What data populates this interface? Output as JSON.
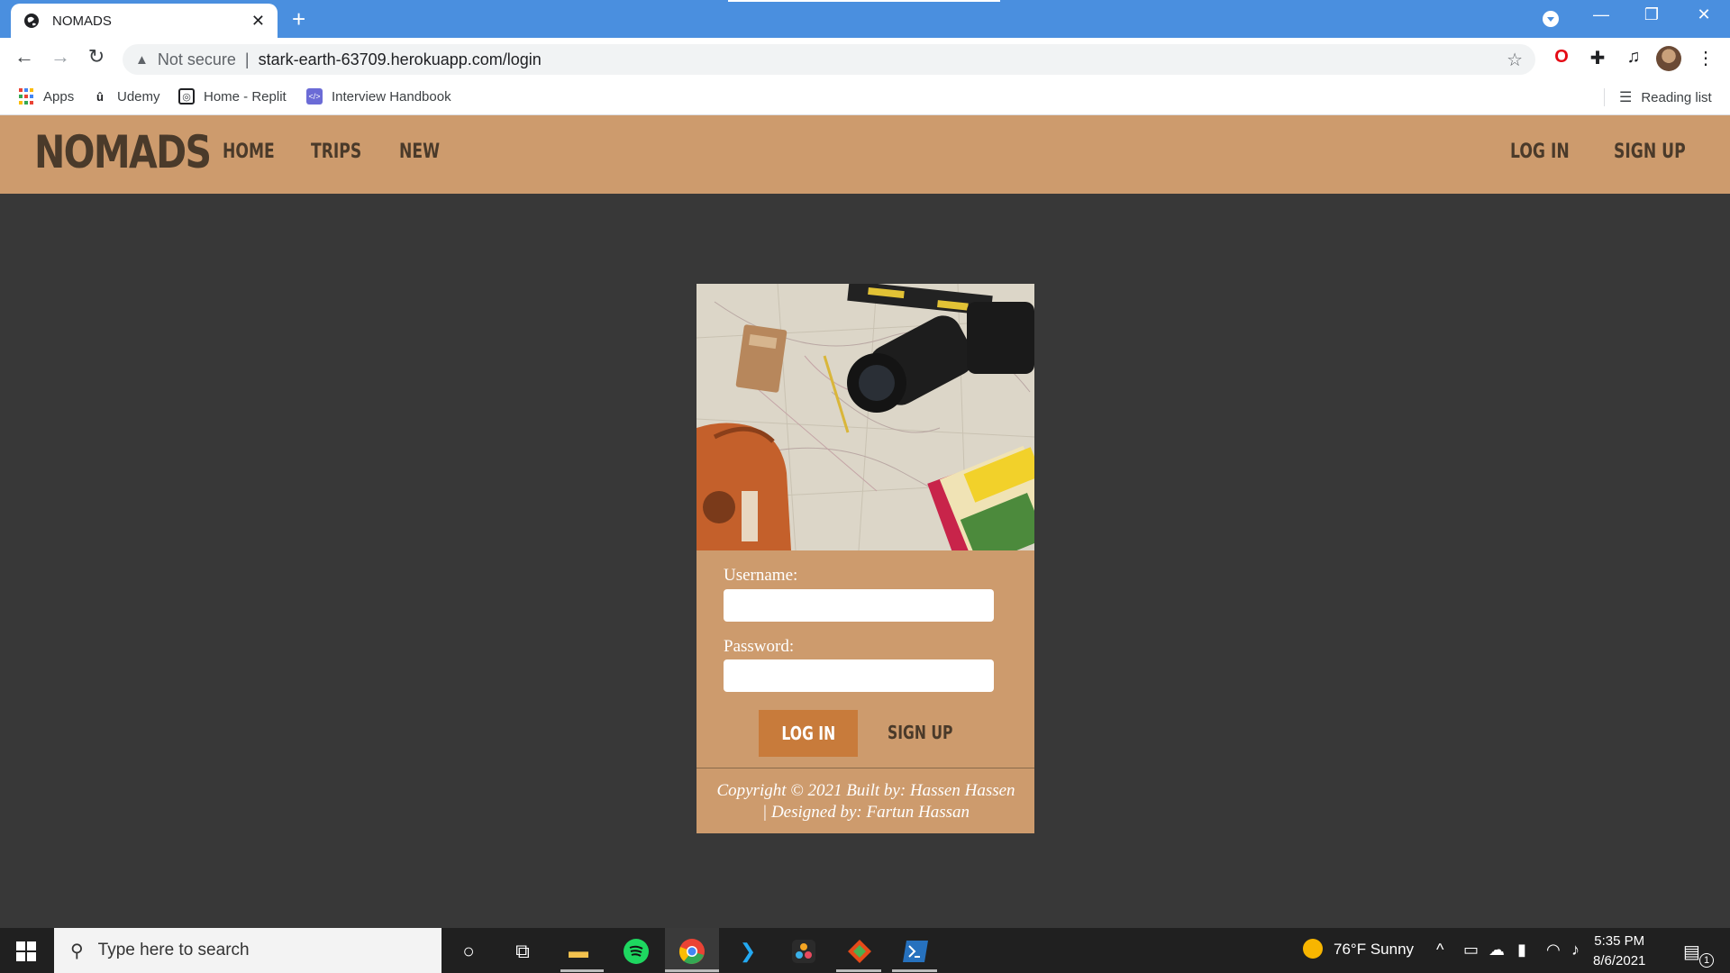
{
  "browser": {
    "tab_title": "NOMADS",
    "omnibox": {
      "security": "Not secure",
      "url": "stark-earth-63709.herokuapp.com/login"
    },
    "bookmarks": [
      {
        "label": "Apps",
        "icon": "apps-grid-icon"
      },
      {
        "label": "Udemy",
        "icon": "udemy-icon"
      },
      {
        "label": "Home - Replit",
        "icon": "replit-icon"
      },
      {
        "label": "Interview Handbook",
        "icon": "handbook-icon"
      }
    ],
    "reading_list": "Reading list"
  },
  "site": {
    "logo": "NOMADS",
    "nav_left": [
      "HOME",
      "TRIPS",
      "NEW"
    ],
    "nav_right": [
      "LOG IN",
      "SIGN UP"
    ],
    "accent_color": "#cd9b6d",
    "background_color": "#383838"
  },
  "login": {
    "username_label": "Username:",
    "password_label": "Password:",
    "login_button": "LOG IN",
    "signup_link": "SIGN UP",
    "footer_line1": "Copyright © 2021 Built by: Hassen Hassen",
    "footer_line2": "| Designed by: Fartun Hassan"
  },
  "taskbar": {
    "search_placeholder": "Type here to search",
    "weather": "76°F  Sunny",
    "time": "5:35 PM",
    "date": "8/6/2021",
    "notification_count": "1"
  }
}
